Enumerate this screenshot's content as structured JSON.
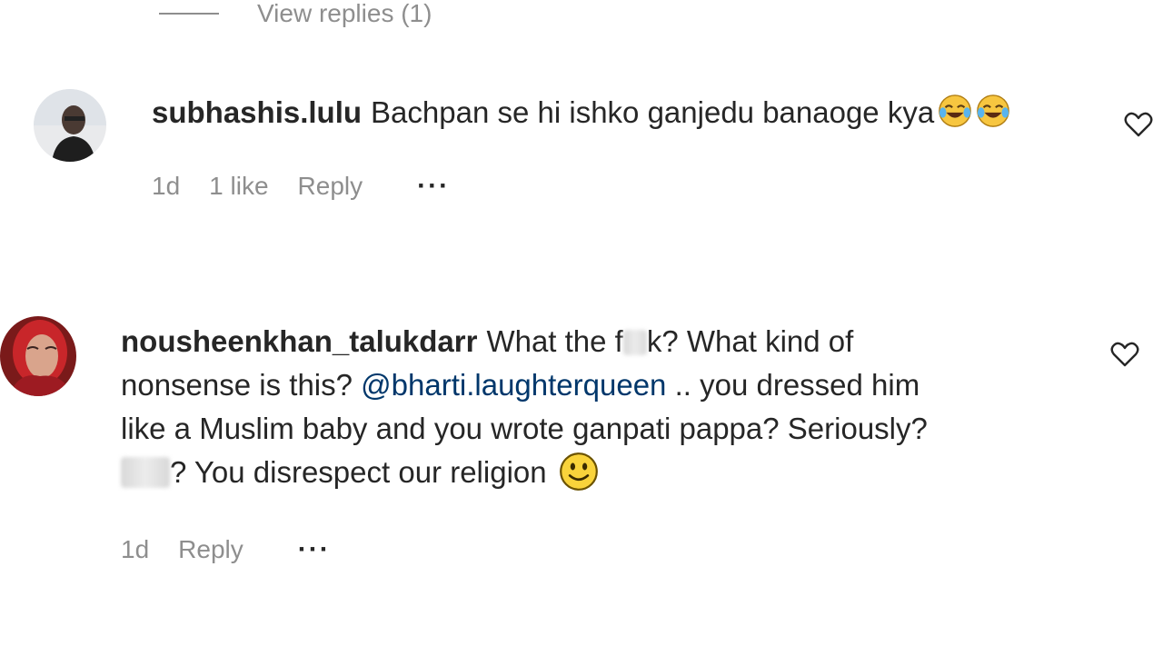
{
  "top": {
    "view_replies": "View replies (1)"
  },
  "comments": [
    {
      "username": "subhashis.lulu",
      "text": "Bachpan se hi ishko ganjedu banaoge kya",
      "time": "1d",
      "likes": "1 like",
      "reply": "Reply",
      "more": "···",
      "emoji": [
        "face-with-tears-of-joy",
        "face-with-tears-of-joy"
      ]
    },
    {
      "username": "nousheenkhan_talukdarr",
      "text_a": "What the f",
      "text_b": "k? What kind of",
      "text_c": "nonsense is this?",
      "mention": "@bharti.laughterqueen",
      "text_d": ".. you dressed him",
      "text_e": "like a Muslim baby and you wrote ganpati pappa? Seriously?",
      "text_f": "? You disrespect our religion",
      "time": "1d",
      "reply": "Reply",
      "more": "···",
      "emoji": [
        "slightly-smiling-face"
      ]
    }
  ],
  "icons": [
    "heart-outline-icon",
    "more-options-icon"
  ]
}
